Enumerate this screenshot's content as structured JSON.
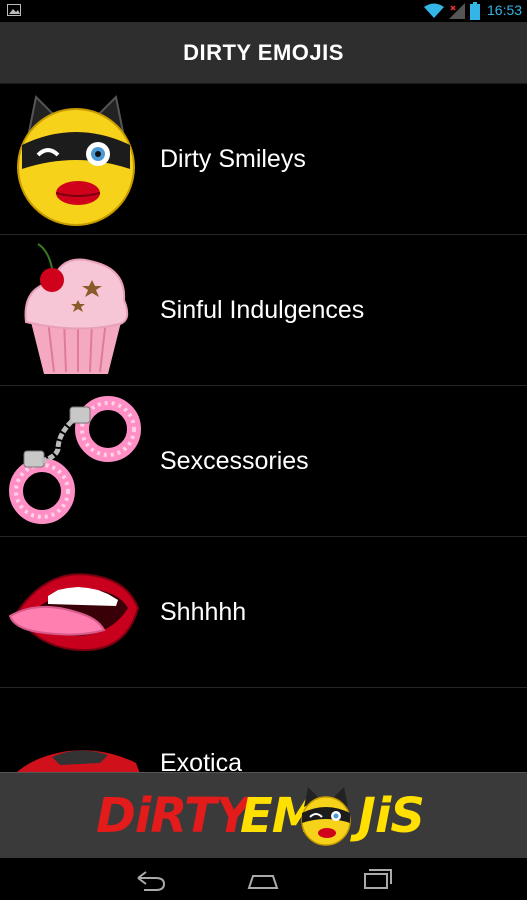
{
  "status_bar": {
    "time": "16:53"
  },
  "app_bar": {
    "title": "DIRTY EMOJIS"
  },
  "categories": [
    {
      "label": "Dirty Smileys",
      "icon": "winking-cat-smiley-icon"
    },
    {
      "label": "Sinful Indulgences",
      "icon": "cupcake-icon"
    },
    {
      "label": "Sexcessories",
      "icon": "fluffy-handcuffs-icon"
    },
    {
      "label": "Shhhhh",
      "icon": "mouth-tongue-icon"
    },
    {
      "label": "Exotica",
      "icon": "red-sports-car-icon"
    }
  ],
  "banner": {
    "logo_part1": "DiRTY",
    "logo_part2": "EM",
    "logo_part3": "JiS"
  },
  "colors": {
    "accent": "#33b5e5",
    "logo_red": "#e31b1b",
    "logo_yellow": "#ffe000"
  }
}
